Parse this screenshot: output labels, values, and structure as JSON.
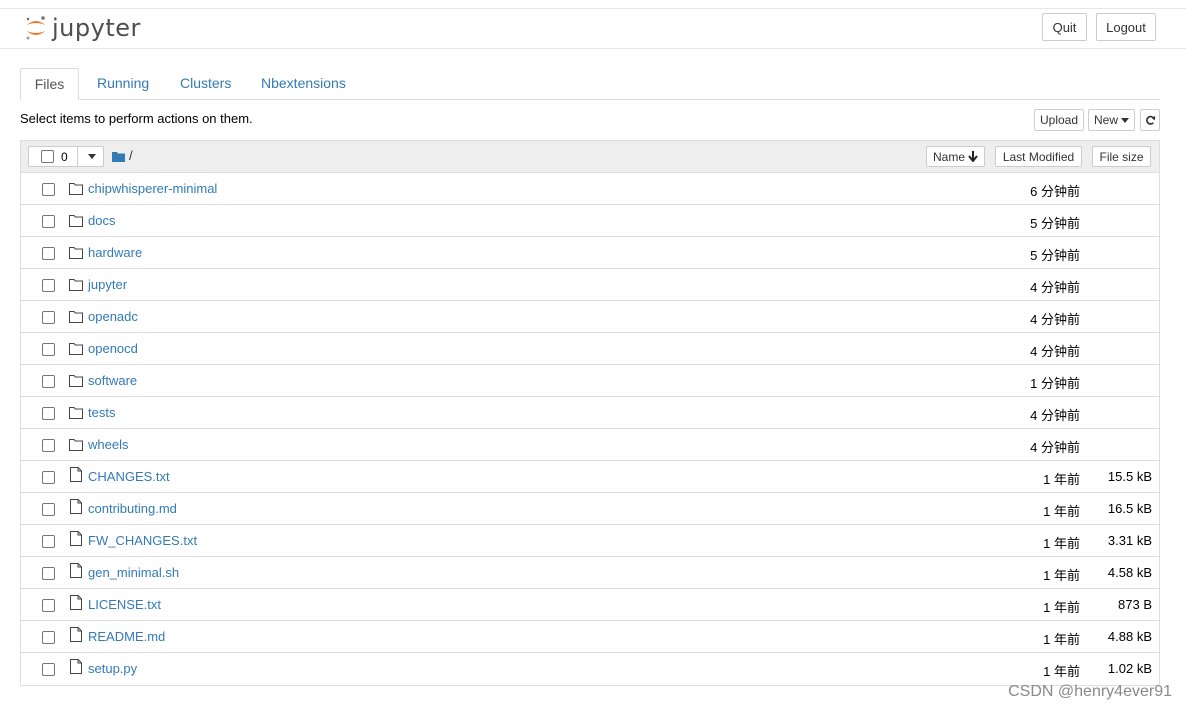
{
  "header": {
    "logo_text": "jupyter",
    "quit_label": "Quit",
    "logout_label": "Logout"
  },
  "tabs": [
    {
      "label": "Files",
      "active": true
    },
    {
      "label": "Running",
      "active": false
    },
    {
      "label": "Clusters",
      "active": false
    },
    {
      "label": "Nbextensions",
      "active": false
    }
  ],
  "toolbar": {
    "instruction": "Select items to perform actions on them.",
    "upload_label": "Upload",
    "new_label": "New",
    "refresh_icon": "refresh-icon"
  },
  "list_header": {
    "selected_count": "0",
    "path": "/",
    "name_label": "Name",
    "last_modified_label": "Last Modified",
    "file_size_label": "File size"
  },
  "items": [
    {
      "type": "folder",
      "name": "chipwhisperer-minimal",
      "modified": "6 分钟前",
      "size": ""
    },
    {
      "type": "folder",
      "name": "docs",
      "modified": "5 分钟前",
      "size": ""
    },
    {
      "type": "folder",
      "name": "hardware",
      "modified": "5 分钟前",
      "size": ""
    },
    {
      "type": "folder",
      "name": "jupyter",
      "modified": "4 分钟前",
      "size": ""
    },
    {
      "type": "folder",
      "name": "openadc",
      "modified": "4 分钟前",
      "size": ""
    },
    {
      "type": "folder",
      "name": "openocd",
      "modified": "4 分钟前",
      "size": ""
    },
    {
      "type": "folder",
      "name": "software",
      "modified": "1 分钟前",
      "size": ""
    },
    {
      "type": "folder",
      "name": "tests",
      "modified": "4 分钟前",
      "size": ""
    },
    {
      "type": "folder",
      "name": "wheels",
      "modified": "4 分钟前",
      "size": ""
    },
    {
      "type": "file",
      "name": "CHANGES.txt",
      "modified": "1 年前",
      "size": "15.5 kB"
    },
    {
      "type": "file",
      "name": "contributing.md",
      "modified": "1 年前",
      "size": "16.5 kB"
    },
    {
      "type": "file",
      "name": "FW_CHANGES.txt",
      "modified": "1 年前",
      "size": "3.31 kB"
    },
    {
      "type": "file",
      "name": "gen_minimal.sh",
      "modified": "1 年前",
      "size": "4.58 kB"
    },
    {
      "type": "file",
      "name": "LICENSE.txt",
      "modified": "1 年前",
      "size": "873 B"
    },
    {
      "type": "file",
      "name": "README.md",
      "modified": "1 年前",
      "size": "4.88 kB"
    },
    {
      "type": "file",
      "name": "setup.py",
      "modified": "1 年前",
      "size": "1.02 kB"
    }
  ],
  "watermark": "CSDN @henry4ever91",
  "colors": {
    "link": "#337ab7",
    "logo_orange": "#f37726",
    "header_bg": "#eeeeee"
  }
}
